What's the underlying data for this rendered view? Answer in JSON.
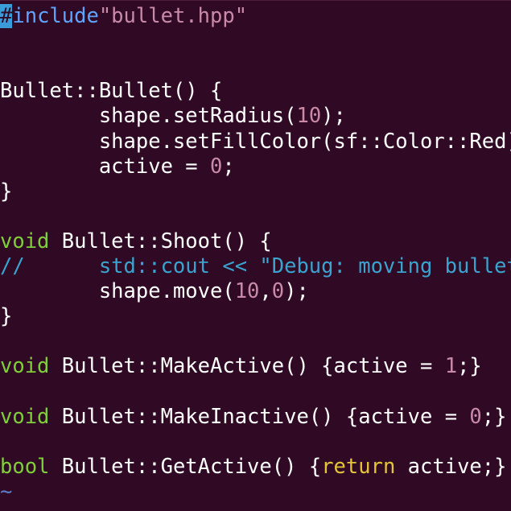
{
  "editor": {
    "lines": [
      {
        "tokens": [
          {
            "text": "#",
            "cls": "tok-preproc cursor"
          },
          {
            "text": "include",
            "cls": "tok-preproc"
          },
          {
            "text": "\"bullet.hpp\"",
            "cls": "tok-string"
          }
        ]
      },
      {
        "tokens": [
          {
            "text": "",
            "cls": ""
          }
        ]
      },
      {
        "tokens": [
          {
            "text": "",
            "cls": ""
          }
        ]
      },
      {
        "tokens": [
          {
            "text": "Bullet::Bullet() {",
            "cls": ""
          }
        ]
      },
      {
        "tokens": [
          {
            "text": "        shape.setRadius(",
            "cls": ""
          },
          {
            "text": "10",
            "cls": "tok-number"
          },
          {
            "text": ");",
            "cls": ""
          }
        ]
      },
      {
        "tokens": [
          {
            "text": "        shape.setFillColor(sf::Color::Red);",
            "cls": ""
          }
        ]
      },
      {
        "tokens": [
          {
            "text": "        active = ",
            "cls": ""
          },
          {
            "text": "0",
            "cls": "tok-number"
          },
          {
            "text": ";",
            "cls": ""
          }
        ]
      },
      {
        "tokens": [
          {
            "text": "}",
            "cls": ""
          }
        ]
      },
      {
        "tokens": [
          {
            "text": "",
            "cls": ""
          }
        ]
      },
      {
        "tokens": [
          {
            "text": "void",
            "cls": "tok-keyword"
          },
          {
            "text": " Bullet::Shoot() {",
            "cls": ""
          }
        ]
      },
      {
        "tokens": [
          {
            "text": "//      std::cout << \"Debug: moving bullet\" << std::endl;",
            "cls": "tok-comment"
          }
        ]
      },
      {
        "tokens": [
          {
            "text": "        shape.move(",
            "cls": ""
          },
          {
            "text": "10",
            "cls": "tok-number"
          },
          {
            "text": ",",
            "cls": ""
          },
          {
            "text": "0",
            "cls": "tok-number"
          },
          {
            "text": ");",
            "cls": ""
          }
        ]
      },
      {
        "tokens": [
          {
            "text": "}",
            "cls": ""
          }
        ]
      },
      {
        "tokens": [
          {
            "text": "",
            "cls": ""
          }
        ]
      },
      {
        "tokens": [
          {
            "text": "void",
            "cls": "tok-keyword"
          },
          {
            "text": " Bullet::MakeActive() {active = ",
            "cls": ""
          },
          {
            "text": "1",
            "cls": "tok-number"
          },
          {
            "text": ";}",
            "cls": ""
          }
        ]
      },
      {
        "tokens": [
          {
            "text": "",
            "cls": ""
          }
        ]
      },
      {
        "tokens": [
          {
            "text": "void",
            "cls": "tok-keyword"
          },
          {
            "text": " Bullet::MakeInactive() {active = ",
            "cls": ""
          },
          {
            "text": "0",
            "cls": "tok-number"
          },
          {
            "text": ";}",
            "cls": ""
          }
        ]
      },
      {
        "tokens": [
          {
            "text": "",
            "cls": ""
          }
        ]
      },
      {
        "tokens": [
          {
            "text": "bool",
            "cls": "tok-keyword"
          },
          {
            "text": " Bullet::GetActive() {",
            "cls": ""
          },
          {
            "text": "return",
            "cls": "tok-return"
          },
          {
            "text": " active;}",
            "cls": ""
          }
        ]
      },
      {
        "tokens": [
          {
            "text": "~",
            "cls": "tok-tilde"
          }
        ]
      }
    ]
  },
  "colors": {
    "background": "#300a24",
    "preprocessor": "#5fa4ff",
    "string": "#c88aa8",
    "number": "#c88aa8",
    "keyword": "#7fcf3a",
    "comment": "#3aa3d0",
    "return_keyword": "#e3c537",
    "cursor": "#3a9dda"
  }
}
